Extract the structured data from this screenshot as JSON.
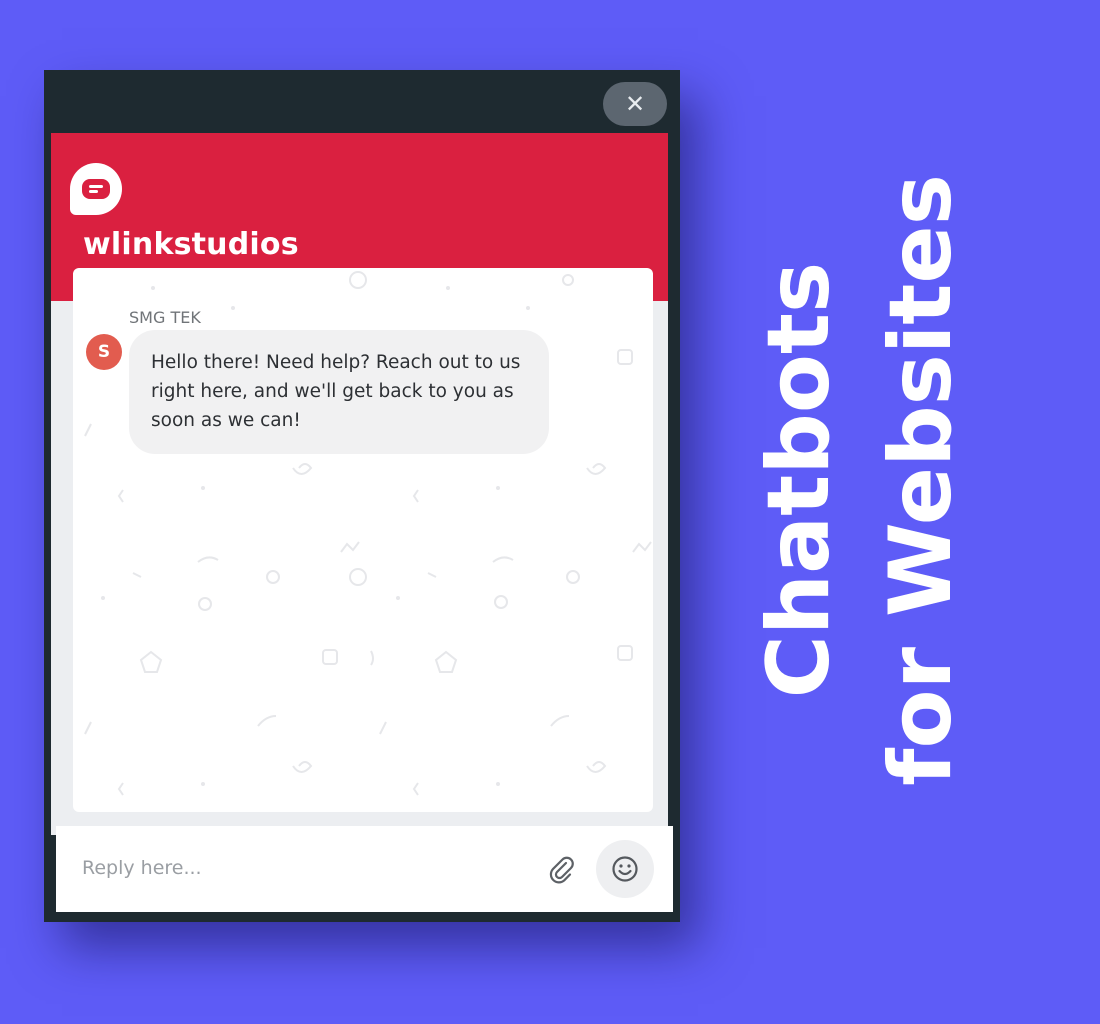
{
  "widget": {
    "close_label": "✕",
    "brand_name": "wlinkstudios",
    "colors": {
      "header": "#da2040",
      "background": "#5e5cf7",
      "frame": "#1e2a30"
    }
  },
  "message": {
    "sender": "SMG TEK",
    "avatar_initial": "S",
    "text": "Hello there! Need help? Reach out to us right here, and we'll get back to you as soon as we can!"
  },
  "reply": {
    "placeholder": "Reply here..."
  },
  "icons": {
    "logo": "chat-bubble-icon",
    "attach": "paperclip-icon",
    "emoji": "smiley-icon",
    "close": "close-icon"
  },
  "side_title": {
    "line1": "Chatbots",
    "line2": "for Websites"
  }
}
